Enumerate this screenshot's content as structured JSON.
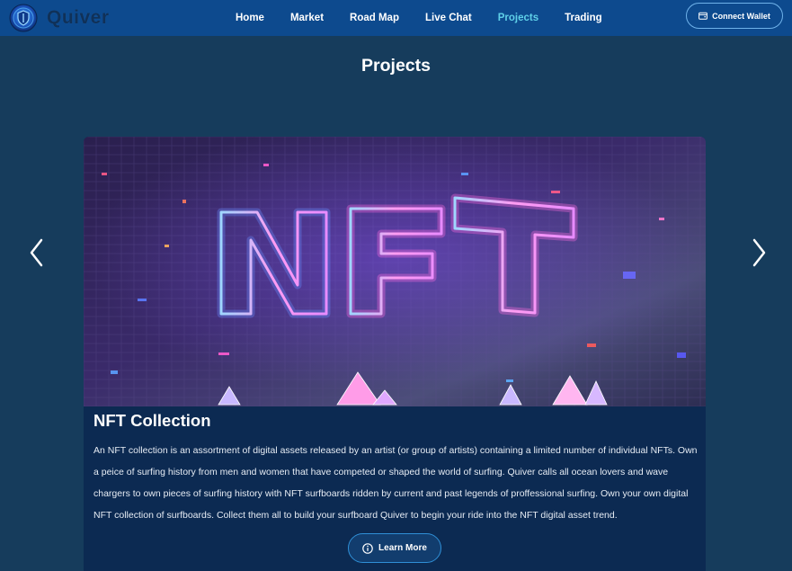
{
  "brand": {
    "name": "Quiver",
    "logo_icon": "shield-logo-icon"
  },
  "nav": {
    "items": [
      {
        "label": "Home"
      },
      {
        "label": "Market"
      },
      {
        "label": "Road Map"
      },
      {
        "label": "Live Chat"
      },
      {
        "label": "Projects",
        "active": true
      },
      {
        "label": "Trading"
      }
    ],
    "wallet_label": "Connect Wallet",
    "wallet_icon": "wallet-icon"
  },
  "page": {
    "title": "Projects"
  },
  "carousel": {
    "prev_icon": "chevron-left-icon",
    "next_icon": "chevron-right-icon",
    "slide": {
      "image_text": "NFT",
      "title": "NFT Collection",
      "description": "An NFT collection is an assortment of digital assets released by an artist (or group of artists) containing a limited number of individual NFTs. Own a peice of surfing history from men and women that have competed or shaped the world of surfing. Quiver calls all ocean lovers and wave chargers to own pieces of surfing history with NFT surfboards ridden by current and past legends of proffessional surfing. Own your own digital NFT collection of surfboards. Collect them all to build your surfboard Quiver to begin your ride into the NFT digital asset trend.",
      "button_label": "Learn More",
      "button_icon": "info-circle-icon"
    }
  },
  "colors": {
    "nav_bg": "#0d4a8e",
    "page_bg": "#163c5c",
    "card_bg": "#0c2a52",
    "active_link": "#5fd0e8"
  }
}
